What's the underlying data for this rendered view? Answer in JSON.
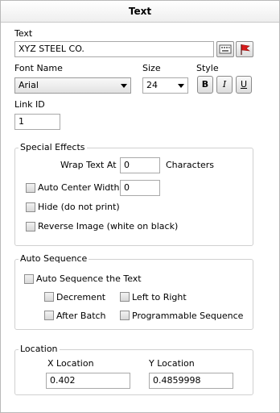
{
  "panel": {
    "title": "Text"
  },
  "text": {
    "label": "Text",
    "value": "XYZ STEEL CO.",
    "icons": [
      "keyboard-icon",
      "flag-icon"
    ]
  },
  "font": {
    "name_label": "Font Name",
    "name_value": "Arial",
    "size_label": "Size",
    "size_value": "24",
    "style_label": "Style",
    "bold": "B",
    "italic": "I",
    "underline": "U"
  },
  "link": {
    "label": "Link ID",
    "value": "1"
  },
  "special_effects": {
    "title": "Special Effects",
    "wrap_label": "Wrap Text At",
    "wrap_value": "0",
    "wrap_units": "Characters",
    "auto_center_label": "Auto Center Width",
    "auto_center_value": "0",
    "hide_label": "Hide (do not print)",
    "reverse_label": "Reverse Image (white on black)"
  },
  "auto_sequence": {
    "title": "Auto Sequence",
    "enable_label": "Auto Sequence the Text",
    "decrement_label": "Decrement",
    "left_to_right_label": "Left to Right",
    "after_batch_label": "After Batch",
    "programmable_label": "Programmable Sequence"
  },
  "location": {
    "title": "Location",
    "x_label": "X Location",
    "x_value": "0.402",
    "y_label": "Y Location",
    "y_value": "0.4859998"
  }
}
